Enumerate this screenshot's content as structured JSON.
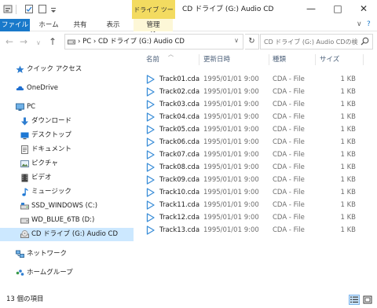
{
  "window": {
    "context_tab": "ドライブ ツール",
    "title": "CD ドライブ (G:) Audio CD",
    "minimize": "—",
    "maximize": "□",
    "close": "✕"
  },
  "ribbon": {
    "tabs": [
      "ファイル",
      "ホーム",
      "共有",
      "表示",
      "管理"
    ],
    "expand": "∨",
    "help": "?"
  },
  "nav": {
    "back": "←",
    "forward": "→",
    "recent": "∨",
    "up": "↑",
    "address": "›  PC  ›  CD ドライブ (G:) Audio CD",
    "address_dropdown": "∨",
    "refresh": "↻",
    "search_placeholder": "CD ドライブ (G:) Audio CDの検索"
  },
  "sidebar": {
    "items": [
      {
        "label": "クイック アクセス",
        "icon": "star-icon"
      },
      {
        "label": "OneDrive",
        "icon": "cloud-icon"
      },
      {
        "label": "PC",
        "icon": "monitor-icon"
      },
      {
        "label": "ダウンロード",
        "icon": "download-icon"
      },
      {
        "label": "デスクトップ",
        "icon": "desktop-icon"
      },
      {
        "label": "ドキュメント",
        "icon": "document-icon"
      },
      {
        "label": "ピクチャ",
        "icon": "pictures-icon"
      },
      {
        "label": "ビデオ",
        "icon": "video-icon"
      },
      {
        "label": "ミュージック",
        "icon": "music-icon"
      },
      {
        "label": "SSD_WINDOWS (C:)",
        "icon": "drive-icon"
      },
      {
        "label": "WD_BLUE_6TB (D:)",
        "icon": "drive-icon"
      },
      {
        "label": "CD ドライブ (G:) Audio CD",
        "icon": "cd-drive-icon"
      },
      {
        "label": "ネットワーク",
        "icon": "network-icon"
      },
      {
        "label": "ホームグループ",
        "icon": "homegroup-icon"
      }
    ]
  },
  "columns": {
    "name": "名前",
    "date": "更新日時",
    "type": "種類",
    "size": "サイズ"
  },
  "files": [
    {
      "name": "Track01.cda",
      "date": "1995/01/01 9:00",
      "type": "CDA - File",
      "size": "1 KB"
    },
    {
      "name": "Track02.cda",
      "date": "1995/01/01 9:00",
      "type": "CDA - File",
      "size": "1 KB"
    },
    {
      "name": "Track03.cda",
      "date": "1995/01/01 9:00",
      "type": "CDA - File",
      "size": "1 KB"
    },
    {
      "name": "Track04.cda",
      "date": "1995/01/01 9:00",
      "type": "CDA - File",
      "size": "1 KB"
    },
    {
      "name": "Track05.cda",
      "date": "1995/01/01 9:00",
      "type": "CDA - File",
      "size": "1 KB"
    },
    {
      "name": "Track06.cda",
      "date": "1995/01/01 9:00",
      "type": "CDA - File",
      "size": "1 KB"
    },
    {
      "name": "Track07.cda",
      "date": "1995/01/01 9:00",
      "type": "CDA - File",
      "size": "1 KB"
    },
    {
      "name": "Track08.cda",
      "date": "1995/01/01 9:00",
      "type": "CDA - File",
      "size": "1 KB"
    },
    {
      "name": "Track09.cda",
      "date": "1995/01/01 9:00",
      "type": "CDA - File",
      "size": "1 KB"
    },
    {
      "name": "Track10.cda",
      "date": "1995/01/01 9:00",
      "type": "CDA - File",
      "size": "1 KB"
    },
    {
      "name": "Track11.cda",
      "date": "1995/01/01 9:00",
      "type": "CDA - File",
      "size": "1 KB"
    },
    {
      "name": "Track12.cda",
      "date": "1995/01/01 9:00",
      "type": "CDA - File",
      "size": "1 KB"
    },
    {
      "name": "Track13.cda",
      "date": "1995/01/01 9:00",
      "type": "CDA - File",
      "size": "1 KB"
    }
  ],
  "status": {
    "count": "13 個の項目"
  },
  "colors": {
    "accent": "#1979ca",
    "context_tab": "#f3db60",
    "selection": "#cce8ff",
    "play_icon": "#3b8ed8"
  }
}
